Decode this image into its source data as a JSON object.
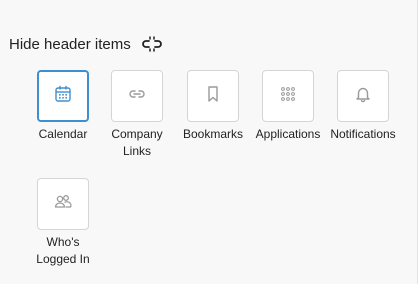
{
  "header": {
    "title": "Hide header items",
    "icon": "link-unlink-icon"
  },
  "items": [
    {
      "key": "calendar",
      "label": "Calendar",
      "icon": "calendar-icon",
      "selected": true
    },
    {
      "key": "company_links",
      "label": "Company Links",
      "icon": "link-icon",
      "selected": false
    },
    {
      "key": "bookmarks",
      "label": "Bookmarks",
      "icon": "bookmark-icon",
      "selected": false
    },
    {
      "key": "applications",
      "label": "Applications",
      "icon": "grid-icon",
      "selected": false
    },
    {
      "key": "notifications",
      "label": "Notifications",
      "icon": "bell-icon",
      "selected": false
    },
    {
      "key": "whos_logged_in",
      "label": "Who's Logged In",
      "icon": "users-icon",
      "selected": false
    }
  ],
  "colors": {
    "accent": "#3f8fcf",
    "icon": "#9a9a9a",
    "background": "#f8f8f8"
  }
}
